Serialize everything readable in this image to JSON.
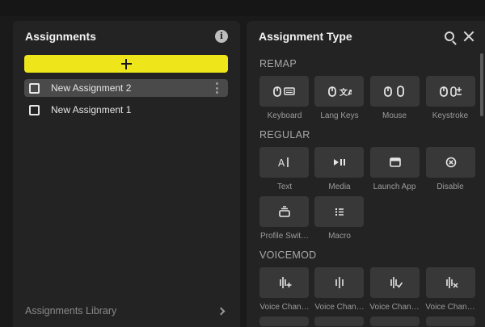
{
  "assignments": {
    "title": "Assignments",
    "info_icon": "info-icon",
    "add_icon": "plus-icon",
    "accent": "#eee51b",
    "items": [
      {
        "label": "New Assignment 2",
        "selected": true
      },
      {
        "label": "New Assignment 1",
        "selected": false
      }
    ],
    "library_label": "Assignments Library"
  },
  "assignment_type": {
    "title": "Assignment Type",
    "search_icon": "search-icon",
    "close_icon": "close-icon",
    "sections": [
      {
        "label": "REMAP",
        "items": [
          {
            "label": "Keyboard",
            "icon": "mouse-keyboard-icon"
          },
          {
            "label": "Lang Keys",
            "icon": "mouse-translate-icon"
          },
          {
            "label": "Mouse",
            "icon": "mouse-mouse-icon"
          },
          {
            "label": "Keystroke",
            "icon": "mouse-keystroke-icon"
          }
        ]
      },
      {
        "label": "REGULAR",
        "items": [
          {
            "label": "Text",
            "icon": "text-cursor-icon"
          },
          {
            "label": "Media",
            "icon": "play-pause-icon"
          },
          {
            "label": "Launch App",
            "icon": "app-window-icon"
          },
          {
            "label": "Disable",
            "icon": "disable-icon"
          },
          {
            "label": "Profile Swit…",
            "icon": "profile-switch-icon"
          },
          {
            "label": "Macro",
            "icon": "macro-list-icon"
          }
        ]
      },
      {
        "label": "VOICEMOD",
        "items": [
          {
            "label": "Voice Chan…",
            "icon": "voice-plus-icon"
          },
          {
            "label": "Voice Chan…",
            "icon": "voice-icon"
          },
          {
            "label": "Voice Chan…",
            "icon": "voice-check-icon"
          },
          {
            "label": "Voice Chan…",
            "icon": "voice-x-icon"
          }
        ]
      }
    ]
  }
}
